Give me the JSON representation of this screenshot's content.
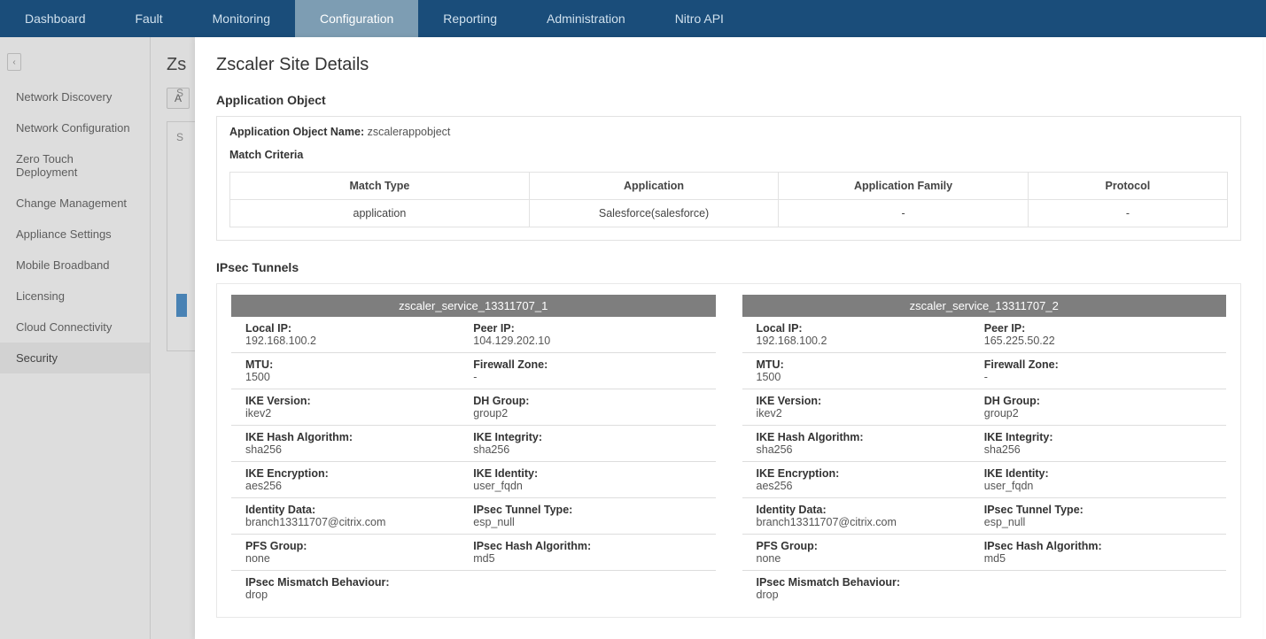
{
  "topnav": {
    "items": [
      {
        "label": "Dashboard"
      },
      {
        "label": "Fault"
      },
      {
        "label": "Monitoring"
      },
      {
        "label": "Configuration",
        "active": true
      },
      {
        "label": "Reporting"
      },
      {
        "label": "Administration"
      },
      {
        "label": "Nitro API"
      }
    ]
  },
  "sidebar": {
    "items": [
      {
        "label": "Network Discovery"
      },
      {
        "label": "Network Configuration"
      },
      {
        "label": "Zero Touch Deployment"
      },
      {
        "label": "Change Management"
      },
      {
        "label": "Appliance Settings"
      },
      {
        "label": "Mobile Broadband"
      },
      {
        "label": "Licensing"
      },
      {
        "label": "Cloud Connectivity"
      },
      {
        "label": "Security",
        "active": true
      }
    ]
  },
  "behind": {
    "title_prefix": "Zs",
    "btn_fragment": "A",
    "s1": "S",
    "s2": "S"
  },
  "modal": {
    "title": "Zscaler Site Details",
    "app_object": {
      "section_title": "Application Object",
      "name_label": "Application Object Name:",
      "name_value": "zscalerappobject",
      "match_title": "Match Criteria",
      "columns": [
        "Match Type",
        "Application",
        "Application Family",
        "Protocol"
      ],
      "row": {
        "match_type": "application",
        "application": "Salesforce(salesforce)",
        "application_family": "-",
        "protocol": "-"
      }
    },
    "ipsec": {
      "section_title": "IPsec Tunnels",
      "tunnels": [
        {
          "name": "zscaler_service_13311707_1",
          "local_ip_label": "Local IP:",
          "local_ip": "192.168.100.2",
          "peer_ip_label": "Peer IP:",
          "peer_ip": "104.129.202.10",
          "mtu_label": "MTU:",
          "mtu": "1500",
          "fw_zone_label": "Firewall Zone:",
          "fw_zone": "-",
          "ike_ver_label": "IKE Version:",
          "ike_ver": "ikev2",
          "dh_group_label": "DH Group:",
          "dh_group": "group2",
          "ike_hash_label": "IKE Hash Algorithm:",
          "ike_hash": "sha256",
          "ike_integ_label": "IKE Integrity:",
          "ike_integ": "sha256",
          "ike_enc_label": "IKE Encryption:",
          "ike_enc": "aes256",
          "ike_id_label": "IKE Identity:",
          "ike_id": "user_fqdn",
          "id_data_label": "Identity Data:",
          "id_data": "branch13311707@citrix.com",
          "ipsec_type_label": "IPsec Tunnel Type:",
          "ipsec_type": "esp_null",
          "pfs_label": "PFS Group:",
          "pfs": "none",
          "ipsec_hash_label": "IPsec Hash Algorithm:",
          "ipsec_hash": "md5",
          "mismatch_label": "IPsec Mismatch Behaviour:",
          "mismatch": "drop"
        },
        {
          "name": "zscaler_service_13311707_2",
          "local_ip_label": "Local IP:",
          "local_ip": "192.168.100.2",
          "peer_ip_label": "Peer IP:",
          "peer_ip": "165.225.50.22",
          "mtu_label": "MTU:",
          "mtu": "1500",
          "fw_zone_label": "Firewall Zone:",
          "fw_zone": "-",
          "ike_ver_label": "IKE Version:",
          "ike_ver": "ikev2",
          "dh_group_label": "DH Group:",
          "dh_group": "group2",
          "ike_hash_label": "IKE Hash Algorithm:",
          "ike_hash": "sha256",
          "ike_integ_label": "IKE Integrity:",
          "ike_integ": "sha256",
          "ike_enc_label": "IKE Encryption:",
          "ike_enc": "aes256",
          "ike_id_label": "IKE Identity:",
          "ike_id": "user_fqdn",
          "id_data_label": "Identity Data:",
          "id_data": "branch13311707@citrix.com",
          "ipsec_type_label": "IPsec Tunnel Type:",
          "ipsec_type": "esp_null",
          "pfs_label": "PFS Group:",
          "pfs": "none",
          "ipsec_hash_label": "IPsec Hash Algorithm:",
          "ipsec_hash": "md5",
          "mismatch_label": "IPsec Mismatch Behaviour:",
          "mismatch": "drop"
        }
      ]
    }
  }
}
